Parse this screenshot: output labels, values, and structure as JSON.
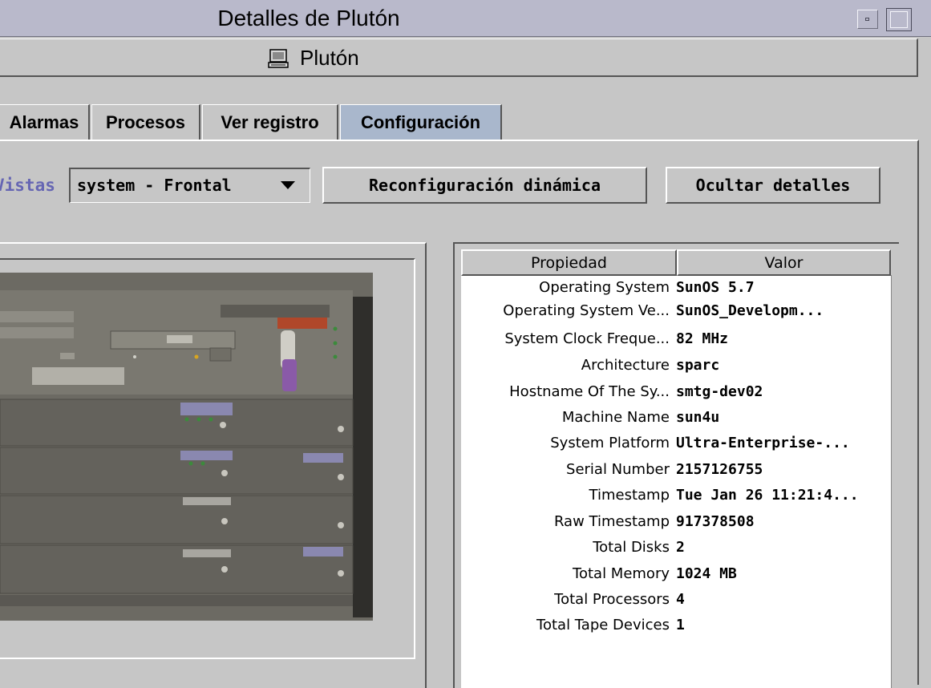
{
  "window": {
    "title": "Detalles de Plutón",
    "host_name": "Plutón"
  },
  "tabs": [
    {
      "label": "Alarmas",
      "active": false
    },
    {
      "label": "Procesos",
      "active": false
    },
    {
      "label": "Ver registro",
      "active": false
    },
    {
      "label": "Configuración",
      "active": true
    }
  ],
  "toolbar": {
    "views_label": "Vistas",
    "views_selected": "system - Frontal",
    "reconfig_button": "Reconfiguración dinámica",
    "hide_details_button": "Ocultar detalles"
  },
  "properties_table": {
    "columns": [
      "Propiedad",
      "Valor"
    ],
    "rows": [
      {
        "property": "Operating System",
        "value": "SunOS 5.7"
      },
      {
        "property": "Operating System Ve...",
        "value": "SunOS_Developm..."
      },
      {
        "property": "System Clock Freque...",
        "value": "82 MHz"
      },
      {
        "property": "Architecture",
        "value": "sparc"
      },
      {
        "property": "Hostname Of The Sy...",
        "value": "smtg-dev02"
      },
      {
        "property": "Machine Name",
        "value": "sun4u"
      },
      {
        "property": "System Platform",
        "value": "Ultra-Enterprise-..."
      },
      {
        "property": "Serial Number",
        "value": "2157126755"
      },
      {
        "property": "Timestamp",
        "value": "Tue Jan 26 11:21:4..."
      },
      {
        "property": "Raw Timestamp",
        "value": "917378508"
      },
      {
        "property": "Total Disks",
        "value": "2"
      },
      {
        "property": "Total Memory",
        "value": "1024 MB"
      },
      {
        "property": "Total Processors",
        "value": "4"
      },
      {
        "property": "Total Tape Devices",
        "value": "1"
      }
    ]
  },
  "colors": {
    "background": "#c6c6c6",
    "titlebar": "#b9b9cb",
    "active_tab": "#a9b7cc",
    "views_label": "#6666b3"
  }
}
